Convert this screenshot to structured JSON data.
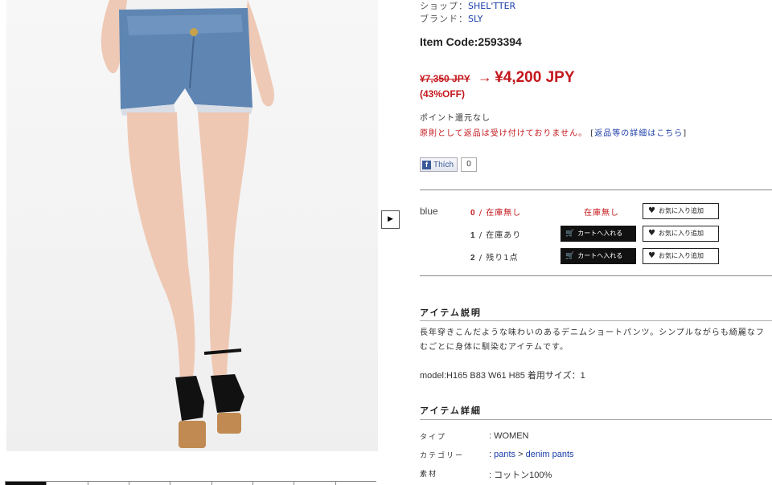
{
  "meta": {
    "shop_label": "ショップ：",
    "shop_value": "SHEL'TTER",
    "brand_label": "ブランド：",
    "brand_value": "SLY"
  },
  "item_code": "Item Code:2593394",
  "price": {
    "original": "¥7,350 JPY",
    "arrow": "→",
    "sale": "¥4,200 JPY",
    "discount": "(43%OFF)"
  },
  "points_text": "ポイント還元なし",
  "returns": {
    "policy": "原則として返品は受け付けておりません。",
    "link_open": "[",
    "link_text": "返品等の詳細はこちら",
    "link_close": "]"
  },
  "like": {
    "icon_letter": "f",
    "label": "Thích",
    "count": "0"
  },
  "play_glyph": "▶",
  "variants": {
    "color": "blue",
    "rows": [
      {
        "size": "0",
        "status": "/ 在庫無し",
        "stock_label": "在庫無し",
        "fav_label": "お気に入り追加"
      },
      {
        "size": "1",
        "status": "/ 在庫あり",
        "cart_label": "カートへ入れる",
        "fav_label": "お気に入り追加"
      },
      {
        "size": "2",
        "status": "/ 残り1点",
        "cart_label": "カートへ入れる",
        "fav_label": "お気に入り追加"
      }
    ],
    "cart_glyph": "🛒",
    "heart_glyph": "♥"
  },
  "description": {
    "title": "アイテム説明",
    "line1": "長年穿きこんだような味わいのあるデニムショートパンツ。シンプルながらも綺麗なフ",
    "line2": "むごとに身体に馴染むアイテムです。",
    "model": "model:H165 B83 W61 H85 着用サイズ：1"
  },
  "details": {
    "title": "アイテム詳細",
    "type_label": "タイプ",
    "type_value": ": WOMEN",
    "category_label": "カテゴリー",
    "category_sep": ":",
    "category_1": "pants",
    "category_arrow": ">",
    "category_2": "denim pants",
    "material_label": "素材",
    "material_value": ": コットン100%"
  }
}
